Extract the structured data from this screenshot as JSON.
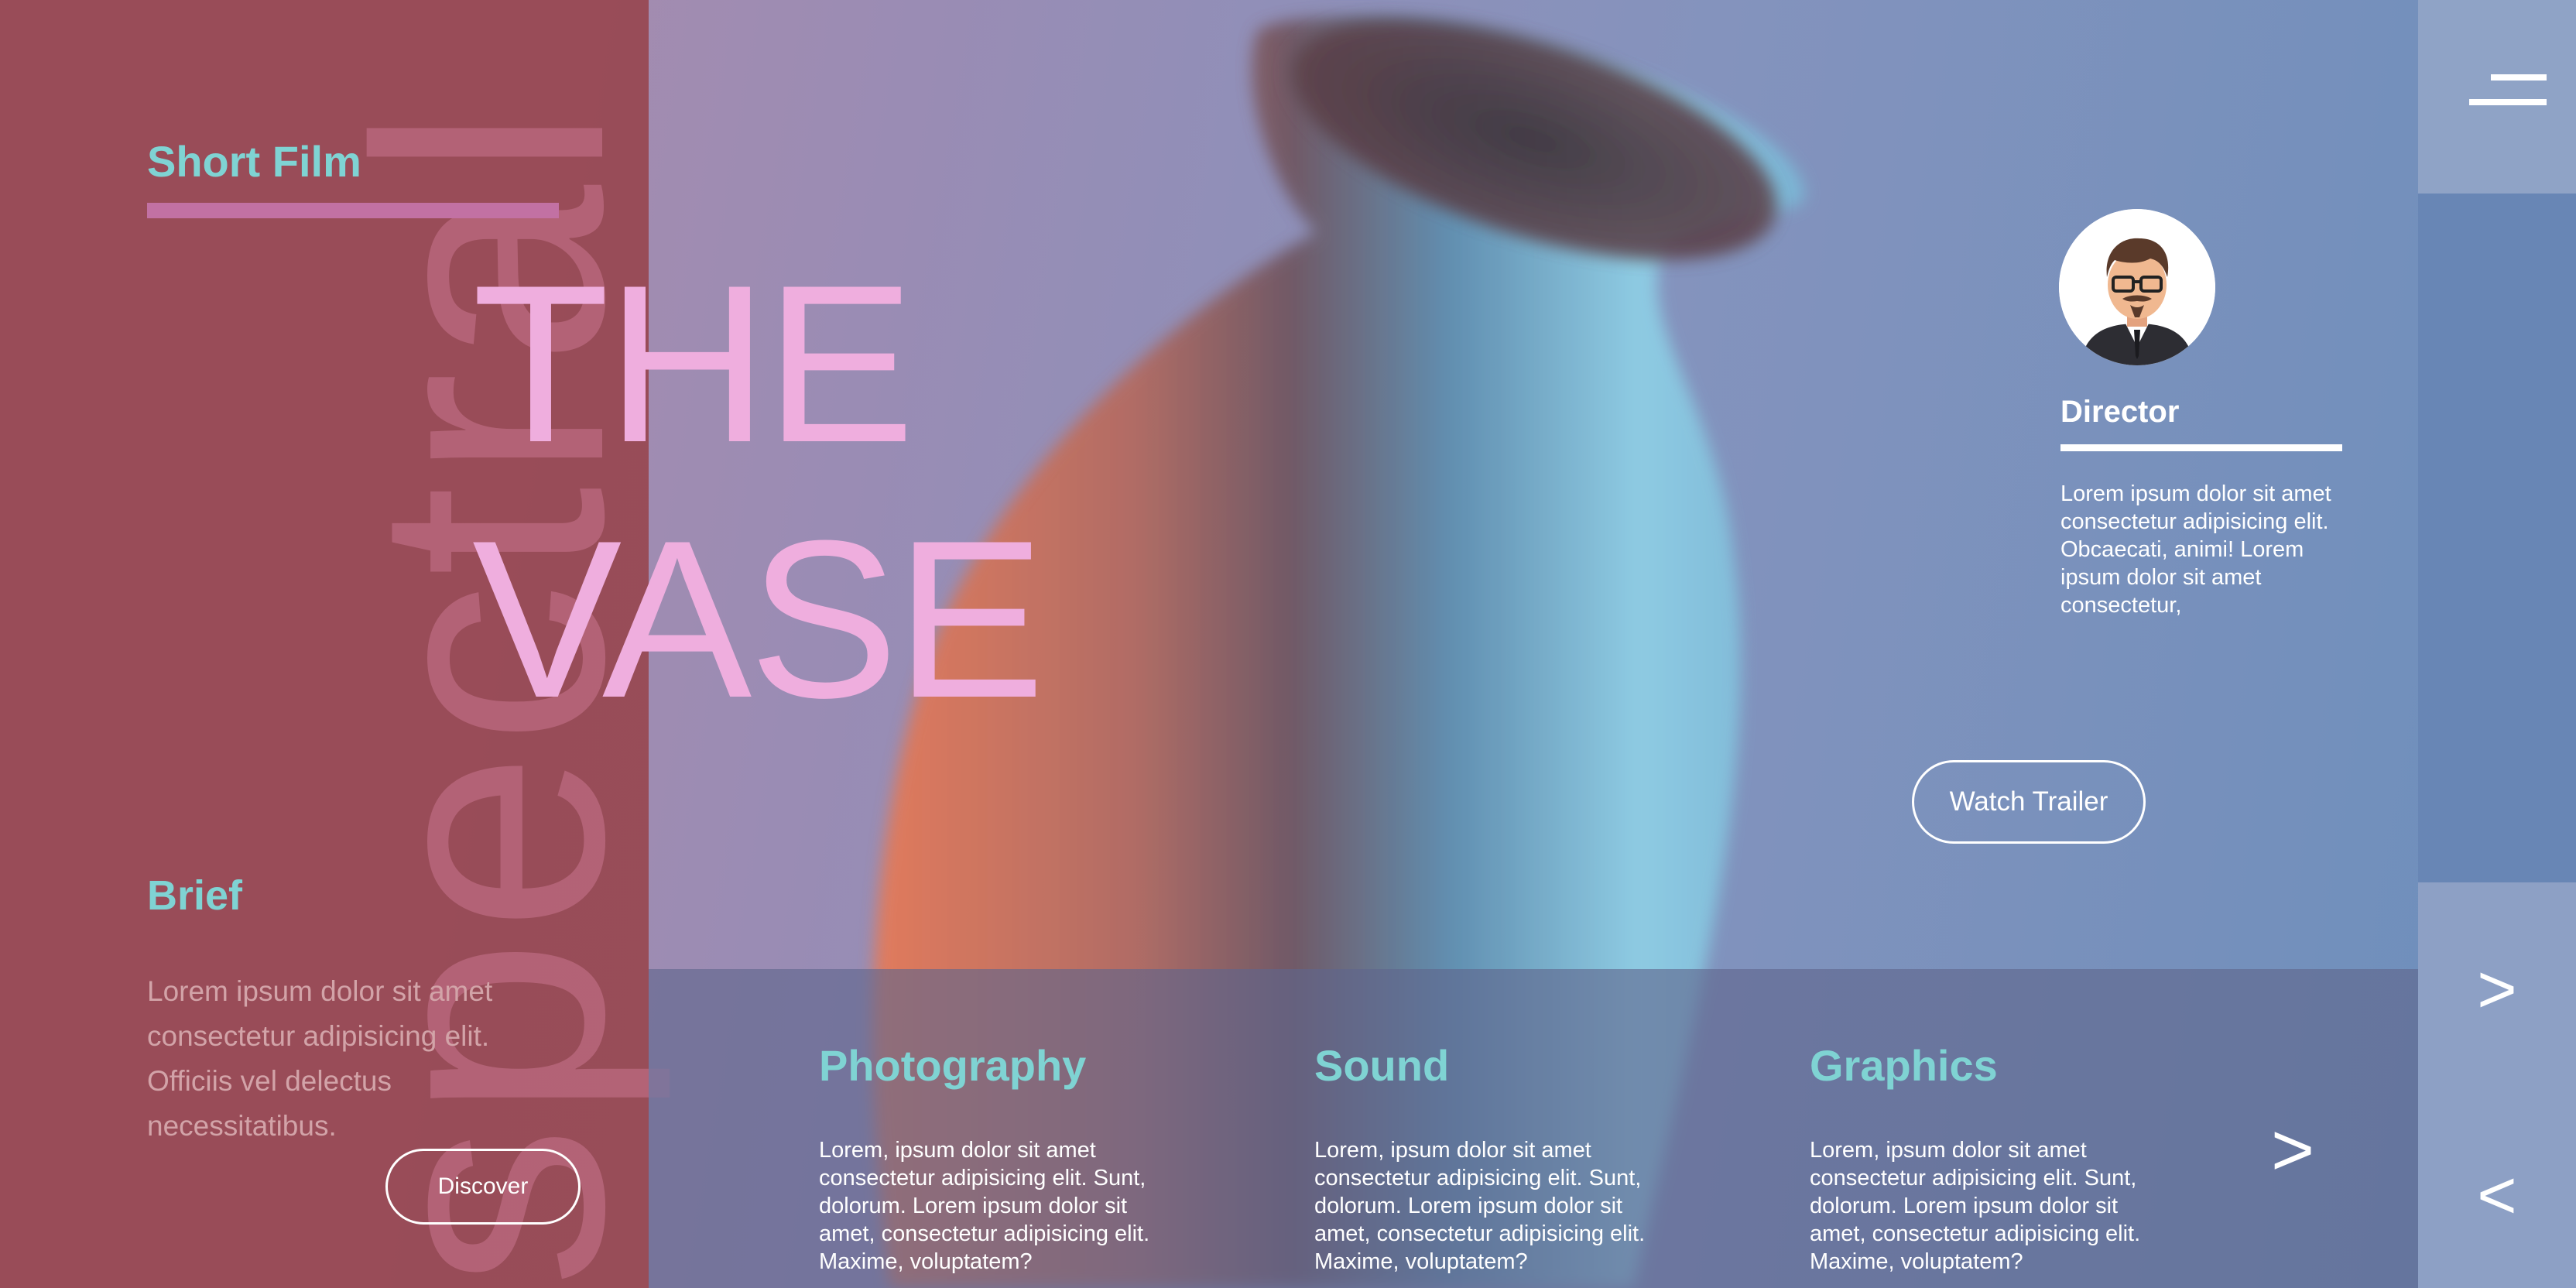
{
  "hero": {
    "side_word": "spectral",
    "kicker": "Short Film",
    "title_line1": "THE",
    "title_line2": "VASE"
  },
  "brief": {
    "title": "Brief",
    "text": "Lorem ipsum dolor sit amet consectetur adipisicing elit. Officiis vel delectus necessitatibus.",
    "button_label": "Discover"
  },
  "director": {
    "label": "Director",
    "text": "Lorem ipsum dolor sit amet consectetur adipisicing elit. Obcaecati, animi! Lorem ipsum dolor sit amet consectetur,",
    "avatar_icon": "director-avatar"
  },
  "trailer": {
    "button_label": "Watch Trailer"
  },
  "features": [
    {
      "title": "Photography",
      "text": "Lorem, ipsum dolor sit amet consectetur adipisicing elit. Sunt, dolorum. Lorem ipsum dolor sit amet, consectetur adipisicing elit. Maxime, voluptatem?"
    },
    {
      "title": "Sound",
      "text": "Lorem, ipsum dolor sit amet consectetur adipisicing elit. Sunt, dolorum. Lorem ipsum dolor sit amet, consectetur adipisicing elit. Maxime, voluptatem?"
    },
    {
      "title": "Graphics",
      "text": "Lorem, ipsum dolor sit amet consectetur adipisicing elit. Sunt, dolorum. Lorem ipsum dolor sit amet, consectetur adipisicing elit. Maxime, voluptatem?"
    }
  ],
  "nav": {
    "features_next": ">",
    "rail_next": ">",
    "rail_prev": "<",
    "menu_icon": "hamburger-menu-icon"
  },
  "colors": {
    "left_panel": "#984a54",
    "accent_teal": "#7fd3d3",
    "title_pink": "#efaede",
    "bar_pink": "#c271a3",
    "rail_mid": "#6886b5"
  }
}
